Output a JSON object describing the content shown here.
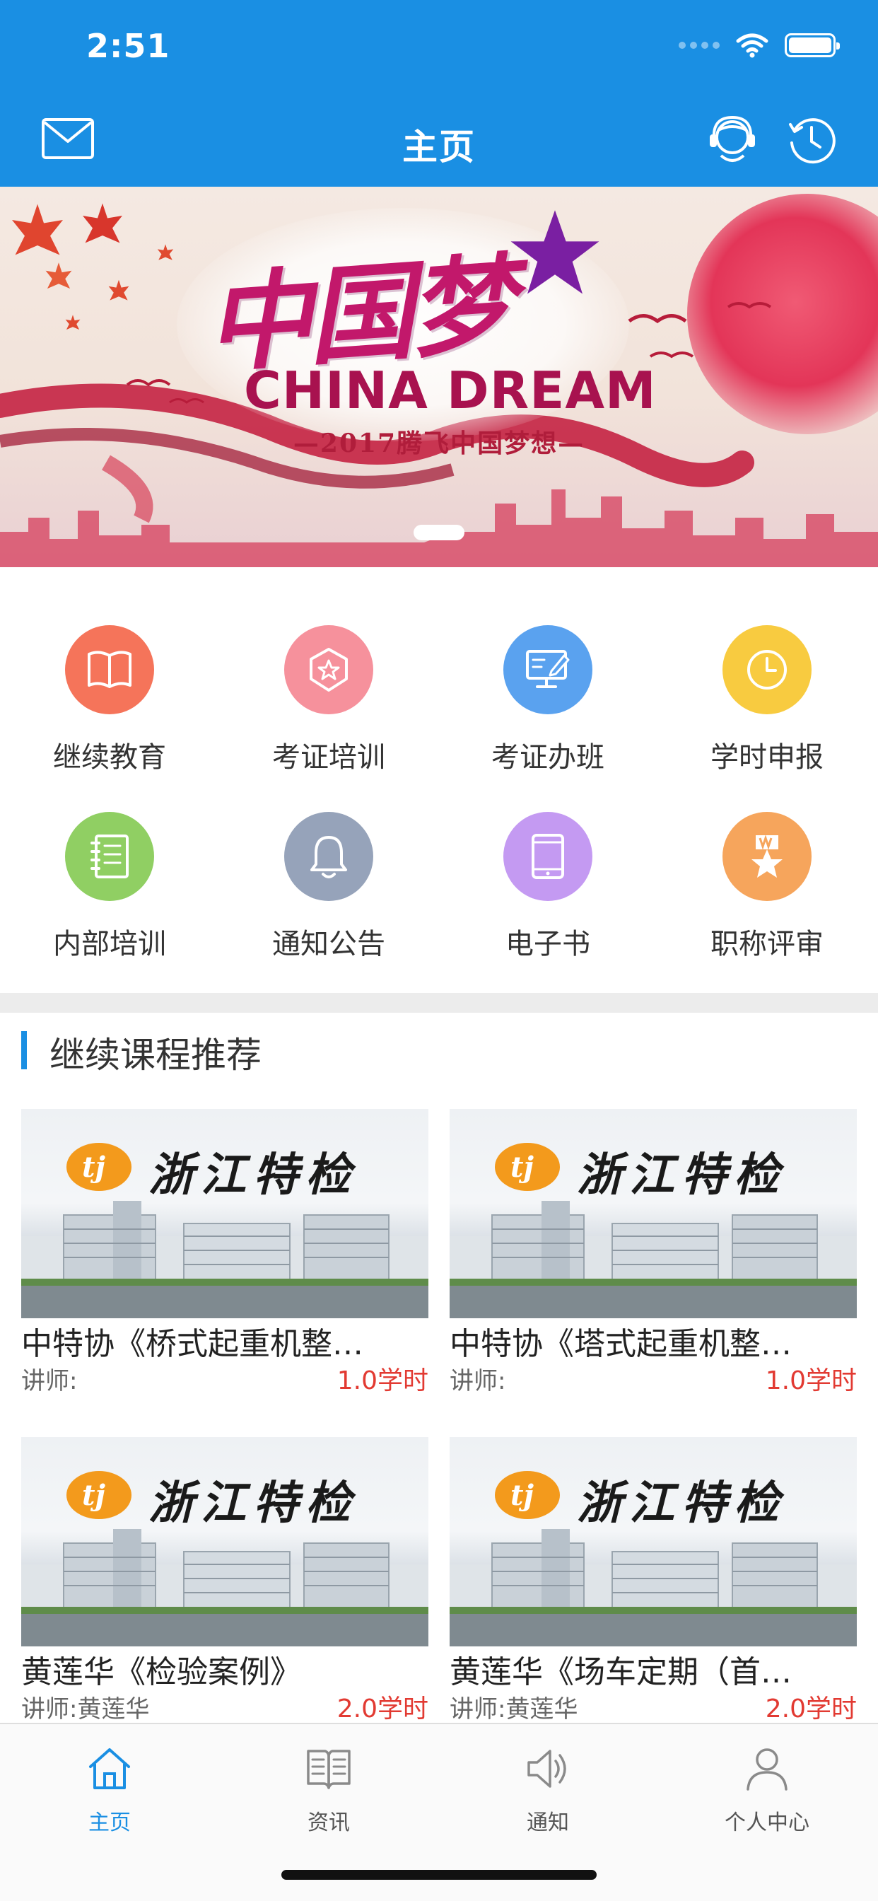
{
  "status_bar": {
    "time": "2:51"
  },
  "nav": {
    "title": "主页"
  },
  "banner": {
    "chinese_title": "中国梦",
    "english_title": "CHINA DREAM",
    "subtitle": "—2017腾飞中国梦想—",
    "active_page": 1
  },
  "menu": {
    "items": [
      {
        "label": "继续教育",
        "icon": "book-icon",
        "color": "#f5745a"
      },
      {
        "label": "考证培训",
        "icon": "badge-star-icon",
        "color": "#f6919c"
      },
      {
        "label": "考证办班",
        "icon": "monitor-pen-icon",
        "color": "#5aa2ef"
      },
      {
        "label": "学时申报",
        "icon": "clock-icon",
        "color": "#f8cb40"
      },
      {
        "label": "内部培训",
        "icon": "notebook-icon",
        "color": "#90cf63"
      },
      {
        "label": "通知公告",
        "icon": "bell-icon",
        "color": "#96a3ba"
      },
      {
        "label": "电子书",
        "icon": "tablet-icon",
        "color": "#c49af2"
      },
      {
        "label": "职称评审",
        "icon": "medal-star-icon",
        "color": "#f6a55c"
      }
    ]
  },
  "section": {
    "title": "继续课程推荐"
  },
  "courses": [
    {
      "image_text": "浙江特检",
      "title": "中特协《桥式起重机整…",
      "teacher": "讲师:",
      "hours": "1.0学时"
    },
    {
      "image_text": "浙江特检",
      "title": "中特协《塔式起重机整…",
      "teacher": "讲师:",
      "hours": "1.0学时"
    },
    {
      "image_text": "浙江特检",
      "title": "黄莲华《检验案例》",
      "teacher": "讲师:黄莲华",
      "hours": "2.0学时"
    },
    {
      "image_text": "浙江特检",
      "title": "黄莲华《场车定期（首…",
      "teacher": "讲师:黄莲华",
      "hours": "2.0学时"
    }
  ],
  "tabbar": {
    "items": [
      {
        "label": "主页",
        "icon": "home-icon",
        "active": true
      },
      {
        "label": "资讯",
        "icon": "open-book-icon",
        "active": false
      },
      {
        "label": "通知",
        "icon": "speaker-icon",
        "active": false
      },
      {
        "label": "个人中心",
        "icon": "person-icon",
        "active": false
      }
    ]
  },
  "colors": {
    "primary": "#1a8fe3",
    "hours_red": "#e23a32"
  }
}
